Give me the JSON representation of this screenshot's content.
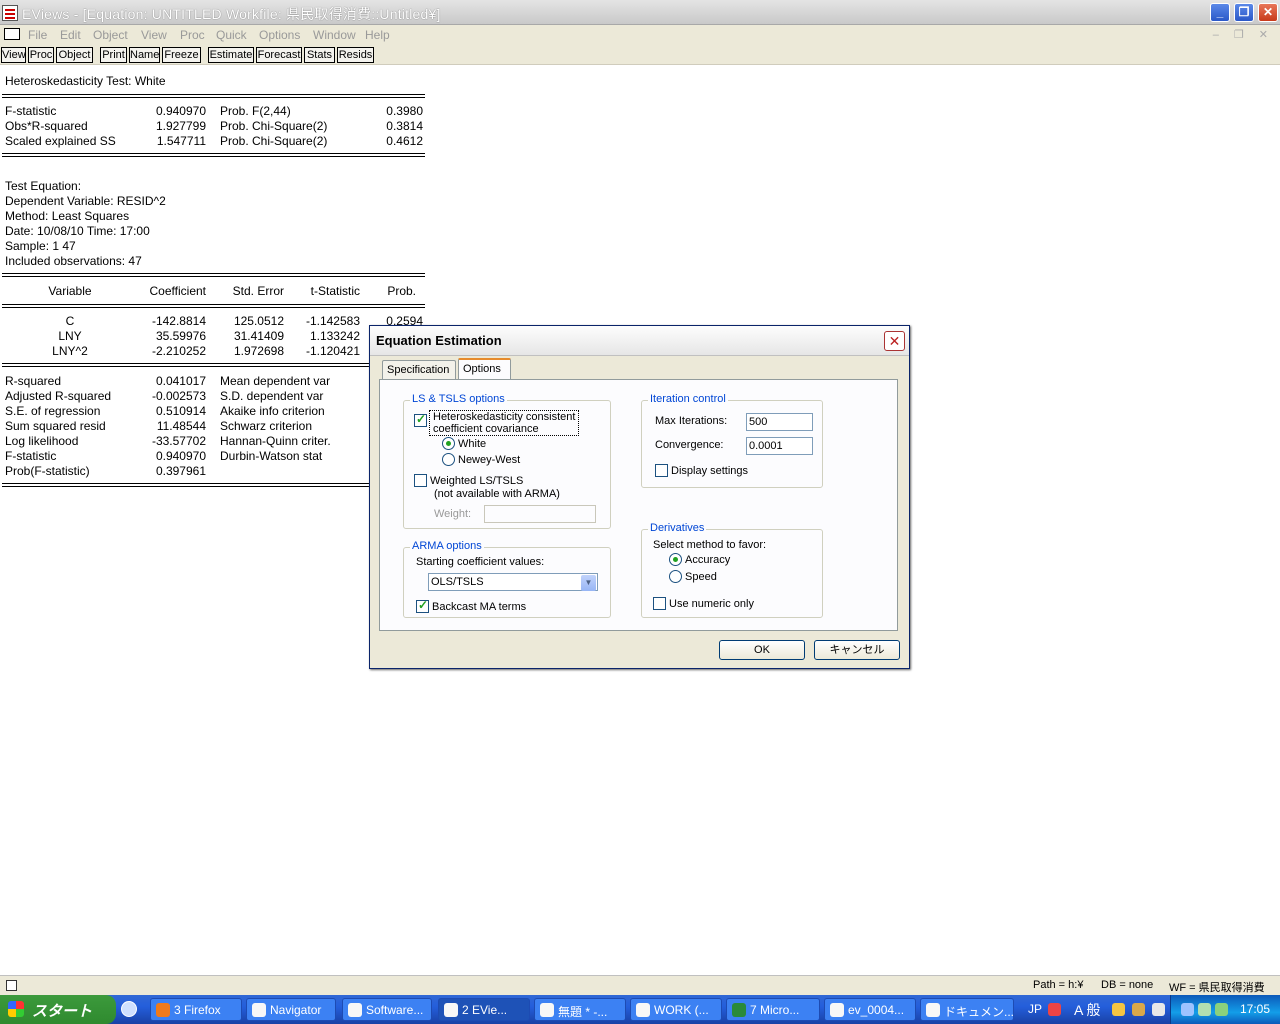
{
  "window": {
    "title": "EViews - [Equation: UNTITLED   Workfile: 県民取得消費::Untitled¥]",
    "minimize_glyph": "_",
    "restore_glyph": "❐",
    "close_glyph": "✕"
  },
  "menu": {
    "items": [
      "File",
      "Edit",
      "Object",
      "View",
      "Proc",
      "Quick",
      "Options",
      "Window",
      "Help"
    ],
    "mdi_controls": "– ❐ ✕"
  },
  "toolbar": {
    "buttons": [
      "View",
      "Proc",
      "Object",
      "Print",
      "Name",
      "Freeze",
      "Estimate",
      "Forecast",
      "Stats",
      "Resids"
    ]
  },
  "output": {
    "test_title": "Heteroskedasticity Test: White",
    "stats": [
      {
        "label": "F-statistic",
        "value": "0.940970",
        "prob_label": "Prob. F(2,44)",
        "prob": "0.3980"
      },
      {
        "label": "Obs*R-squared",
        "value": "1.927799",
        "prob_label": "Prob. Chi-Square(2)",
        "prob": "0.3814"
      },
      {
        "label": "Scaled explained SS",
        "value": "1.547711",
        "prob_label": "Prob. Chi-Square(2)",
        "prob": "0.4612"
      }
    ],
    "info": [
      "Test Equation:",
      "Dependent Variable: RESID^2",
      "Method: Least Squares",
      "Date: 10/08/10   Time: 17:00",
      "Sample: 1 47",
      "Included observations: 47"
    ],
    "coef_headers": [
      "Variable",
      "Coefficient",
      "Std. Error",
      "t-Statistic",
      "Prob."
    ],
    "coef_rows": [
      {
        "variable": "C",
        "coef": "-142.8814",
        "se": "125.0512",
        "t": "-1.142583",
        "prob": "0.2594"
      },
      {
        "variable": "LNY",
        "coef": "35.59976",
        "se": "31.41409",
        "t": "1.133242",
        "prob": ""
      },
      {
        "variable": "LNY^2",
        "coef": "-2.210252",
        "se": "1.972698",
        "t": "-1.120421",
        "prob": ""
      }
    ],
    "summary": [
      {
        "label": "R-squared",
        "value": "0.041017",
        "label2": "Mean dependent var"
      },
      {
        "label": "Adjusted R-squared",
        "value": "-0.002573",
        "label2": "S.D. dependent var"
      },
      {
        "label": "S.E. of regression",
        "value": "0.510914",
        "label2": "Akaike info criterion"
      },
      {
        "label": "Sum squared resid",
        "value": "11.48544",
        "label2": "Schwarz criterion"
      },
      {
        "label": "Log likelihood",
        "value": "-33.57702",
        "label2": "Hannan-Quinn criter."
      },
      {
        "label": "F-statistic",
        "value": "0.940970",
        "label2": "Durbin-Watson stat"
      },
      {
        "label": "Prob(F-statistic)",
        "value": "0.397961",
        "label2": ""
      }
    ]
  },
  "dialog": {
    "title": "Equation Estimation",
    "close_glyph": "✕",
    "tabs": [
      "Specification",
      "Options"
    ],
    "ls_group": {
      "title": "LS & TSLS options",
      "hetero_label_1": "Heteroskedasticity consistent",
      "hetero_label_2": "coefficient covariance",
      "radio_white": "White",
      "radio_newey": "Newey-West",
      "weighted_label_1": "Weighted LS/TSLS",
      "weighted_label_2": "(not available with ARMA)",
      "weight_label": "Weight:",
      "weight_value": ""
    },
    "arma_group": {
      "title": "ARMA options",
      "start_label": "Starting coefficient values:",
      "start_value": "OLS/TSLS",
      "backcast_label": "Backcast MA terms"
    },
    "iter_group": {
      "title": "Iteration control",
      "max_label": "Max Iterations:",
      "max_value": "500",
      "conv_label": "Convergence:",
      "conv_value": "0.0001",
      "display_label": "Display settings"
    },
    "deriv_group": {
      "title": "Derivatives",
      "select_label": "Select method to favor:",
      "radio_accuracy": "Accuracy",
      "radio_speed": "Speed",
      "numeric_label": "Use numeric only"
    },
    "ok_label": "OK",
    "cancel_label": "キャンセル"
  },
  "status": {
    "path": "Path = h:¥",
    "db": "DB = none",
    "wf": "WF = 県民取得消費"
  },
  "taskbar": {
    "start_label": "スタート",
    "tasks": [
      "3 Firefox",
      "Navigator",
      "Software...",
      "2 EVie...",
      "無題 * -...",
      "WORK (...",
      "7 Micro...",
      "ev_0004...",
      "ドキュメン..."
    ],
    "lang": "JP",
    "ime": "A 般",
    "clock": "17:05"
  },
  "colors": {
    "accent": "#0046d5",
    "taskbar": "#245edb",
    "start": "#3c9a3c",
    "checkmark": "#21a121"
  }
}
